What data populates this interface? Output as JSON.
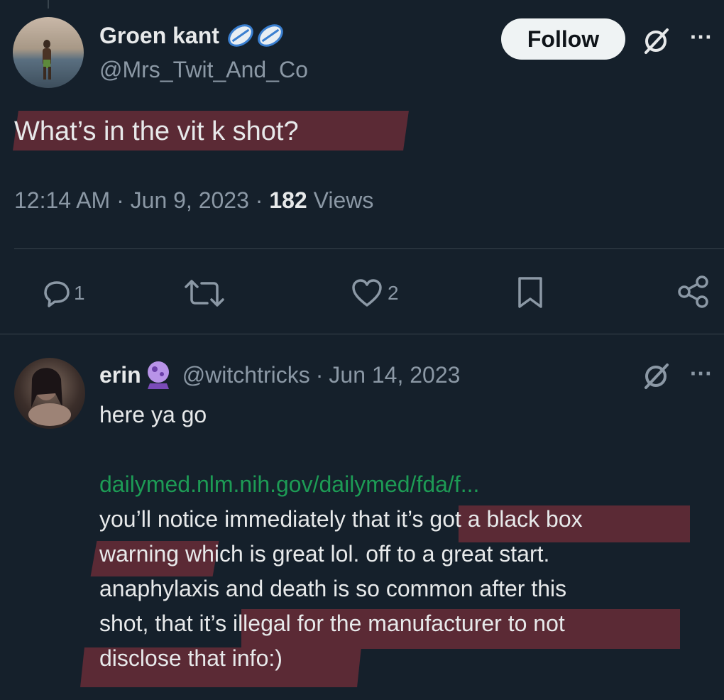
{
  "main_tweet": {
    "display_name": "Groen kant",
    "handle": "@Mrs_Twit_And_Co",
    "follow_label": "Follow",
    "text": "What’s in the vit k shot?",
    "time": "12:14 AM",
    "date": "Jun 9, 2023",
    "views_count": "182",
    "views_label": "Views",
    "sep": "·",
    "reply_count": "1",
    "like_count": "2",
    "more": "···"
  },
  "reply": {
    "display_name": "erin",
    "handle": "@witchtricks",
    "sep": "·",
    "date": "Jun 14, 2023",
    "more": "···",
    "line1": "here ya go",
    "link": "dailymed.nlm.nih.gov/dailymed/fda/f...",
    "line2": "you’ll notice immediately that it’s got a black box",
    "line3": "warning which is great lol. off to a great start.",
    "line4": "anaphylaxis and death is so common after this",
    "line5": "shot, that it’s illegal for the manufacturer to not",
    "line6": "disclose that info:)"
  },
  "colors": {
    "background": "#15202b",
    "highlight": "#5b2a35",
    "link": "#1d9b55",
    "muted": "#8b98a5"
  }
}
